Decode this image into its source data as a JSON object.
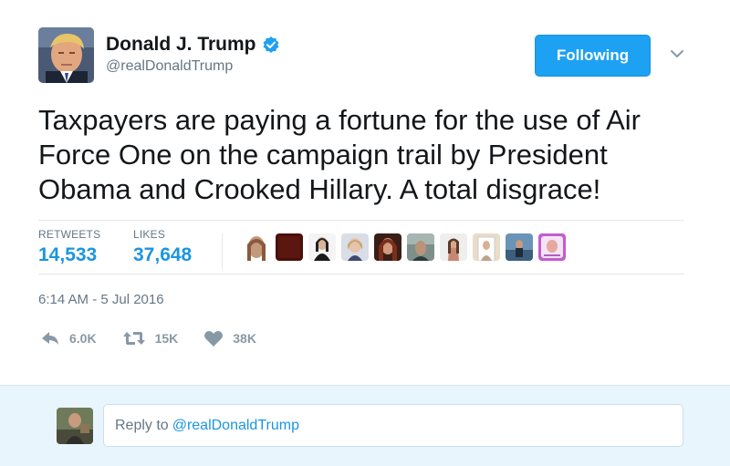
{
  "user": {
    "display_name": "Donald J. Trump",
    "handle": "@realDonaldTrump",
    "verified": true
  },
  "follow_button": {
    "label": "Following"
  },
  "tweet": {
    "text": "Taxpayers are paying a fortune for the use of Air Force One on the campaign trail by President Obama and Crooked Hillary. A total disgrace!",
    "timestamp": "6:14 AM - 5 Jul 2016"
  },
  "stats": {
    "retweets_label": "RETWEETS",
    "retweets_value": "14,533",
    "likes_label": "LIKES",
    "likes_value": "37,648"
  },
  "actions": {
    "reply_count": "6.0K",
    "retweet_count": "15K",
    "like_count": "38K"
  },
  "reply": {
    "prefix": "Reply to",
    "mention": "@realDonaldTrump"
  },
  "colors": {
    "accent": "#1da1f2",
    "link": "#1b95e0",
    "muted": "#657786",
    "reply_bg": "#e8f5fd"
  }
}
